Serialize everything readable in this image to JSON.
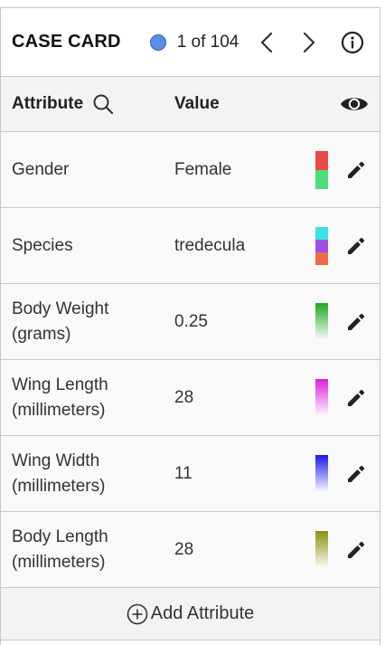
{
  "header": {
    "title": "CASE CARD",
    "count_text": "1 of 104",
    "dot_color": "#5b8fe6"
  },
  "columns": {
    "attribute": "Attribute",
    "value": "Value"
  },
  "rows": [
    {
      "name": "Gender",
      "value": "Female",
      "swatch": [
        "#e84a4a",
        "#4ddd7a"
      ]
    },
    {
      "name": "Species",
      "value": "tredecula",
      "swatch": [
        "#3ee0e0",
        "#a04fe0",
        "#ee6a4a"
      ]
    },
    {
      "name": "Body Weight (grams)",
      "value": "0.25",
      "swatch_gradient": [
        "#1fa81f",
        "#ffffff"
      ]
    },
    {
      "name": "Wing Length (millimeters)",
      "value": "28",
      "swatch_gradient": [
        "#dd20dd",
        "#ffffff"
      ]
    },
    {
      "name": "Wing Width (millimeters)",
      "value": "11",
      "swatch_gradient": [
        "#1a1ae6",
        "#ffffff"
      ]
    },
    {
      "name": "Body Length (millimeters)",
      "value": "28",
      "swatch_gradient": [
        "#8f8f10",
        "#ffffff"
      ]
    }
  ],
  "add_attribute": {
    "label": "Add Attribute"
  },
  "icons": {
    "prev": "chevron-left-icon",
    "next": "chevron-right-icon",
    "info": "info-icon",
    "search": "search-icon",
    "visibility": "eye-icon",
    "edit": "pencil-icon",
    "add": "plus-circle-icon"
  }
}
